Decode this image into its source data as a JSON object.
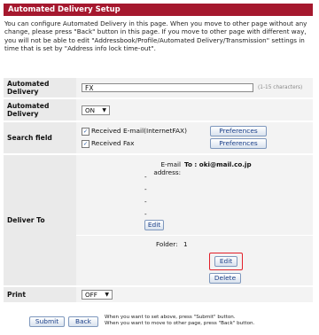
{
  "title": "Automated Delivery Setup",
  "intro": "You can configure Automated Delivery in this page. When you move to other page without any change, please press \"Back\" button in this page. If you move to other page with different way, you will not be able to edit \"Addressbook/Profile/Automated Delivery/Transmission\" settings in time that is set by \"Address info lock time-out\".",
  "fields": {
    "automated_delivery_name": {
      "label": "Automated Delivery",
      "value": "FX",
      "hint": "(1-15 characters)"
    },
    "automated_delivery_switch": {
      "label": "Automated Delivery",
      "value": "ON"
    },
    "search_field": {
      "label": "Search field",
      "options": [
        {
          "label": "Received E-mail(InternetFAX)",
          "checked": true,
          "button": "Preferences"
        },
        {
          "label": "Received Fax",
          "checked": true,
          "button": "Preferences"
        }
      ]
    },
    "deliver_to": {
      "label": "Deliver To",
      "email_label": "E-mail address:",
      "email_to": "To : oki@mail.co.jp",
      "email_blanks": [
        "-",
        "-",
        "-",
        "-"
      ],
      "email_edit": "Edit",
      "folder_label": "Folder:",
      "folder_value": "1",
      "folder_edit": "Edit",
      "folder_delete": "Delete"
    },
    "print": {
      "label": "Print",
      "value": "OFF"
    }
  },
  "footer": {
    "submit": "Submit",
    "back": "Back",
    "note_submit": "When you want to set above, press \"Submit\" button.",
    "note_back": "When you want to move to other page, press \"Back\" button."
  }
}
